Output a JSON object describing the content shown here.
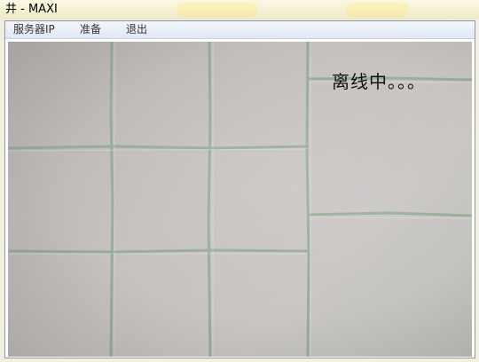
{
  "window": {
    "title": "井 - MAXI"
  },
  "menu": {
    "items": [
      "服务器IP",
      "准备",
      "退出"
    ]
  },
  "video": {
    "status_text": "离线中。。。"
  },
  "colors": {
    "grout": "#8eaa92",
    "tile": "#c4bfbd",
    "menubar": "#dfe8f5"
  }
}
